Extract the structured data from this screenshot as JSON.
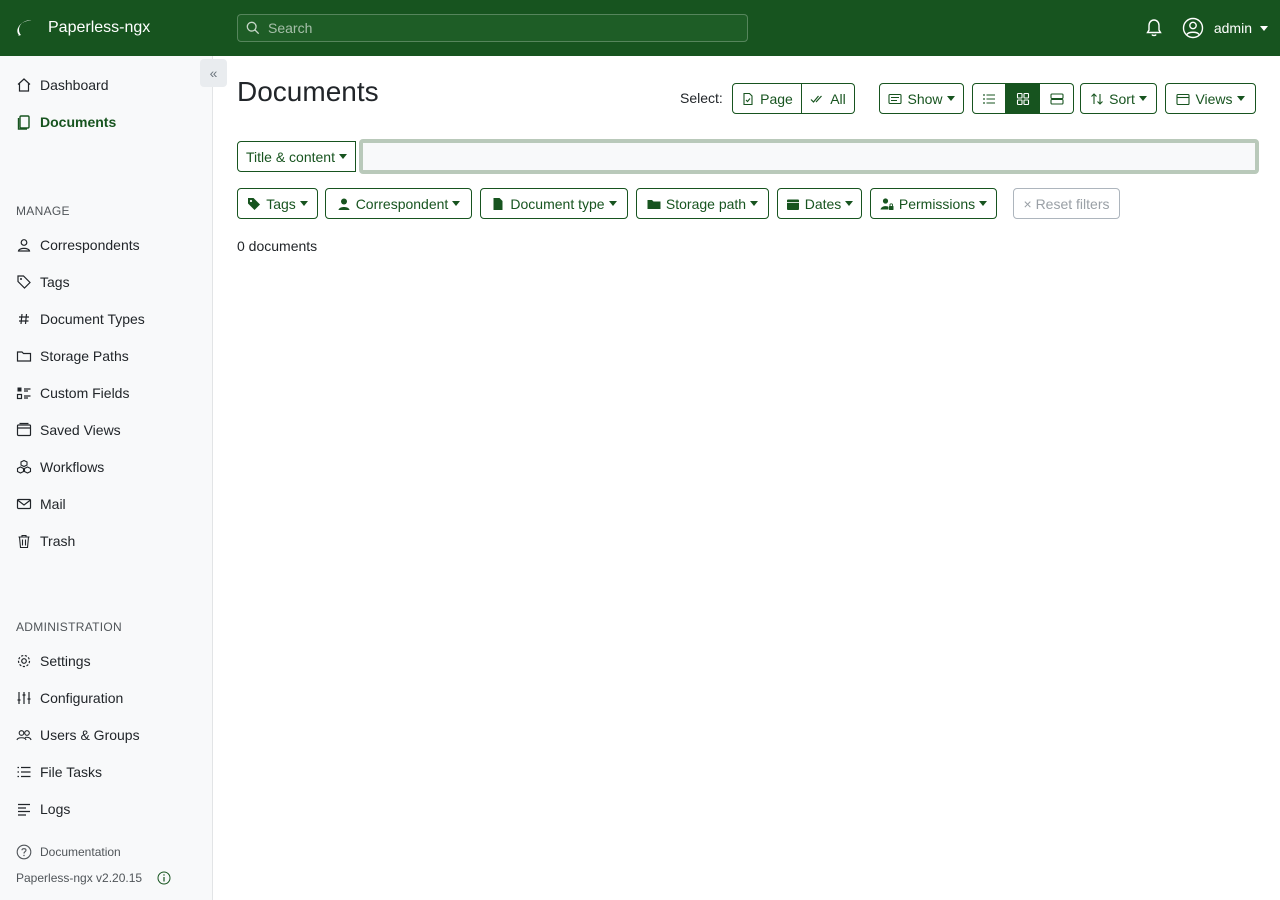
{
  "app": {
    "name": "Paperless-ngx",
    "version": "Paperless-ngx v2.20.15"
  },
  "colors": {
    "primary": "#17541f",
    "sidebar_bg": "#f8f9fa",
    "focus_ring": "#b9c9ba"
  },
  "header": {
    "search_placeholder": "Search",
    "username": "admin"
  },
  "sidebar": {
    "top_items": [
      {
        "label": "Dashboard",
        "icon": "house-icon"
      },
      {
        "label": "Documents",
        "icon": "documents-icon",
        "active": true
      }
    ],
    "manage_label": "MANAGE",
    "manage_items": [
      {
        "label": "Correspondents",
        "icon": "person-icon"
      },
      {
        "label": "Tags",
        "icon": "tags-icon"
      },
      {
        "label": "Document Types",
        "icon": "hash-icon"
      },
      {
        "label": "Storage Paths",
        "icon": "folder-icon"
      },
      {
        "label": "Custom Fields",
        "icon": "ui-checks-icon"
      },
      {
        "label": "Saved Views",
        "icon": "window-stack-icon"
      },
      {
        "label": "Workflows",
        "icon": "boxes-icon"
      },
      {
        "label": "Mail",
        "icon": "envelope-icon"
      },
      {
        "label": "Trash",
        "icon": "trash-icon"
      }
    ],
    "admin_label": "ADMINISTRATION",
    "admin_items": [
      {
        "label": "Settings",
        "icon": "gear-icon"
      },
      {
        "label": "Configuration",
        "icon": "sliders-icon"
      },
      {
        "label": "Users & Groups",
        "icon": "people-icon"
      },
      {
        "label": "File Tasks",
        "icon": "list-task-icon"
      },
      {
        "label": "Logs",
        "icon": "text-left-icon"
      }
    ],
    "documentation_label": "Documentation"
  },
  "main": {
    "title": "Documents",
    "select_label": "Select:",
    "select_page": "Page",
    "select_all": "All",
    "show_label": "Show",
    "sort_label": "Sort",
    "views_label": "Views",
    "display_mode_active": "grid",
    "search_field_dropdown": "Title & content",
    "filter_value": "",
    "filters": {
      "tags": "Tags",
      "correspondent": "Correspondent",
      "document_type": "Document type",
      "storage_path": "Storage path",
      "dates": "Dates",
      "permissions": "Permissions"
    },
    "reset_filters": "× Reset filters",
    "count": "0 documents"
  }
}
